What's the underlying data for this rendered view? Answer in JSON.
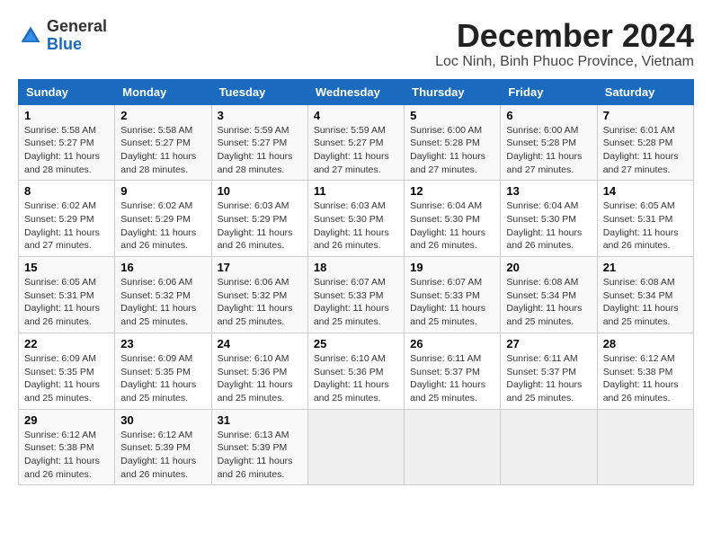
{
  "header": {
    "logo_general": "General",
    "logo_blue": "Blue",
    "month_title": "December 2024",
    "location": "Loc Ninh, Binh Phuoc Province, Vietnam"
  },
  "weekdays": [
    "Sunday",
    "Monday",
    "Tuesday",
    "Wednesday",
    "Thursday",
    "Friday",
    "Saturday"
  ],
  "weeks": [
    [
      {
        "day": 1,
        "sunrise": "5:58 AM",
        "sunset": "5:27 PM",
        "daylight": "11 hours and 28 minutes."
      },
      {
        "day": 2,
        "sunrise": "5:58 AM",
        "sunset": "5:27 PM",
        "daylight": "11 hours and 28 minutes."
      },
      {
        "day": 3,
        "sunrise": "5:59 AM",
        "sunset": "5:27 PM",
        "daylight": "11 hours and 28 minutes."
      },
      {
        "day": 4,
        "sunrise": "5:59 AM",
        "sunset": "5:27 PM",
        "daylight": "11 hours and 27 minutes."
      },
      {
        "day": 5,
        "sunrise": "6:00 AM",
        "sunset": "5:28 PM",
        "daylight": "11 hours and 27 minutes."
      },
      {
        "day": 6,
        "sunrise": "6:00 AM",
        "sunset": "5:28 PM",
        "daylight": "11 hours and 27 minutes."
      },
      {
        "day": 7,
        "sunrise": "6:01 AM",
        "sunset": "5:28 PM",
        "daylight": "11 hours and 27 minutes."
      }
    ],
    [
      {
        "day": 8,
        "sunrise": "6:02 AM",
        "sunset": "5:29 PM",
        "daylight": "11 hours and 27 minutes."
      },
      {
        "day": 9,
        "sunrise": "6:02 AM",
        "sunset": "5:29 PM",
        "daylight": "11 hours and 26 minutes."
      },
      {
        "day": 10,
        "sunrise": "6:03 AM",
        "sunset": "5:29 PM",
        "daylight": "11 hours and 26 minutes."
      },
      {
        "day": 11,
        "sunrise": "6:03 AM",
        "sunset": "5:30 PM",
        "daylight": "11 hours and 26 minutes."
      },
      {
        "day": 12,
        "sunrise": "6:04 AM",
        "sunset": "5:30 PM",
        "daylight": "11 hours and 26 minutes."
      },
      {
        "day": 13,
        "sunrise": "6:04 AM",
        "sunset": "5:30 PM",
        "daylight": "11 hours and 26 minutes."
      },
      {
        "day": 14,
        "sunrise": "6:05 AM",
        "sunset": "5:31 PM",
        "daylight": "11 hours and 26 minutes."
      }
    ],
    [
      {
        "day": 15,
        "sunrise": "6:05 AM",
        "sunset": "5:31 PM",
        "daylight": "11 hours and 26 minutes."
      },
      {
        "day": 16,
        "sunrise": "6:06 AM",
        "sunset": "5:32 PM",
        "daylight": "11 hours and 25 minutes."
      },
      {
        "day": 17,
        "sunrise": "6:06 AM",
        "sunset": "5:32 PM",
        "daylight": "11 hours and 25 minutes."
      },
      {
        "day": 18,
        "sunrise": "6:07 AM",
        "sunset": "5:33 PM",
        "daylight": "11 hours and 25 minutes."
      },
      {
        "day": 19,
        "sunrise": "6:07 AM",
        "sunset": "5:33 PM",
        "daylight": "11 hours and 25 minutes."
      },
      {
        "day": 20,
        "sunrise": "6:08 AM",
        "sunset": "5:34 PM",
        "daylight": "11 hours and 25 minutes."
      },
      {
        "day": 21,
        "sunrise": "6:08 AM",
        "sunset": "5:34 PM",
        "daylight": "11 hours and 25 minutes."
      }
    ],
    [
      {
        "day": 22,
        "sunrise": "6:09 AM",
        "sunset": "5:35 PM",
        "daylight": "11 hours and 25 minutes."
      },
      {
        "day": 23,
        "sunrise": "6:09 AM",
        "sunset": "5:35 PM",
        "daylight": "11 hours and 25 minutes."
      },
      {
        "day": 24,
        "sunrise": "6:10 AM",
        "sunset": "5:36 PM",
        "daylight": "11 hours and 25 minutes."
      },
      {
        "day": 25,
        "sunrise": "6:10 AM",
        "sunset": "5:36 PM",
        "daylight": "11 hours and 25 minutes."
      },
      {
        "day": 26,
        "sunrise": "6:11 AM",
        "sunset": "5:37 PM",
        "daylight": "11 hours and 25 minutes."
      },
      {
        "day": 27,
        "sunrise": "6:11 AM",
        "sunset": "5:37 PM",
        "daylight": "11 hours and 25 minutes."
      },
      {
        "day": 28,
        "sunrise": "6:12 AM",
        "sunset": "5:38 PM",
        "daylight": "11 hours and 26 minutes."
      }
    ],
    [
      {
        "day": 29,
        "sunrise": "6:12 AM",
        "sunset": "5:38 PM",
        "daylight": "11 hours and 26 minutes."
      },
      {
        "day": 30,
        "sunrise": "6:12 AM",
        "sunset": "5:39 PM",
        "daylight": "11 hours and 26 minutes."
      },
      {
        "day": 31,
        "sunrise": "6:13 AM",
        "sunset": "5:39 PM",
        "daylight": "11 hours and 26 minutes."
      },
      null,
      null,
      null,
      null
    ]
  ]
}
